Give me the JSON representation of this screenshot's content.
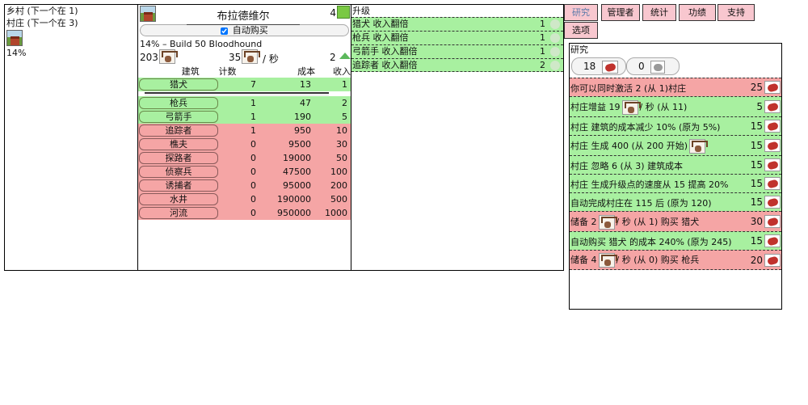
{
  "left": {
    "line1": "乡村 (下一个在 1)",
    "line2": "村庄 (下一个在 3)",
    "percent": "14%"
  },
  "village": {
    "name": "布拉德维尔",
    "count": "4",
    "autobuy_label": "自动购买",
    "autobuy_checked": true,
    "progress_text": "14% – Build 50 Bloodhound",
    "stat_total": "203",
    "stat_rate": "35",
    "stat_rate_unit": "/ 秒",
    "stat_upgrades": "2",
    "headers": {
      "name": "建筑",
      "count": "计数",
      "cost": "成本",
      "income": "收入"
    },
    "buildings": [
      {
        "name": "猎犬",
        "count": "7",
        "cost": "13",
        "income": "1",
        "state": "green"
      },
      {
        "name": "枪兵",
        "count": "1",
        "cost": "47",
        "income": "2",
        "state": "green"
      },
      {
        "name": "弓箭手",
        "count": "1",
        "cost": "190",
        "income": "5",
        "state": "green"
      },
      {
        "name": "追踪者",
        "count": "1",
        "cost": "950",
        "income": "10",
        "state": "red"
      },
      {
        "name": "樵夫",
        "count": "0",
        "cost": "9500",
        "income": "30",
        "state": "red"
      },
      {
        "name": "探路者",
        "count": "0",
        "cost": "19000",
        "income": "50",
        "state": "red"
      },
      {
        "name": "侦察兵",
        "count": "0",
        "cost": "47500",
        "income": "100",
        "state": "red"
      },
      {
        "name": "诱捕者",
        "count": "0",
        "cost": "95000",
        "income": "200",
        "state": "red"
      },
      {
        "name": "水井",
        "count": "0",
        "cost": "190000",
        "income": "500",
        "state": "red"
      },
      {
        "name": "河流",
        "count": "0",
        "cost": "950000",
        "income": "1000",
        "state": "red"
      }
    ]
  },
  "upgrades": {
    "title": "升级",
    "items": [
      {
        "text": "猎犬 收入翻倍",
        "num": "1"
      },
      {
        "text": "枪兵 收入翻倍",
        "num": "1"
      },
      {
        "text": "弓箭手 收入翻倍",
        "num": "1"
      },
      {
        "text": "追踪者 收入翻倍",
        "num": "2"
      }
    ]
  },
  "tabs": [
    {
      "label": "研究",
      "active": true
    },
    {
      "label": "管理者",
      "active": false
    },
    {
      "label": "统计",
      "active": false
    },
    {
      "label": "功绩",
      "active": false
    },
    {
      "label": "支持",
      "active": false
    },
    {
      "label": "选项",
      "active": false
    }
  ],
  "research": {
    "title": "研究",
    "meat_count": "18",
    "stone_count": "0",
    "items": [
      {
        "text": "你可以同时激活 2 (从 1)村庄",
        "num": "25",
        "state": "red"
      },
      {
        "text_a": "村庄增益 19",
        "text_b": "/ 秒 (从 11)",
        "num": "5",
        "state": "green",
        "deer": true
      },
      {
        "text": "村庄 建筑的成本减少 10% (原为 5%)",
        "num": "15",
        "state": "green"
      },
      {
        "text_a": "村庄 生成 400 (从 200 开始)",
        "text_b": "",
        "num": "15",
        "state": "green",
        "deer": true
      },
      {
        "text": "村庄 忽略 6 (从 3) 建筑成本",
        "num": "15",
        "state": "green"
      },
      {
        "text": "村庄 生成升级点的速度从 15 提高 20%",
        "num": "15",
        "state": "green"
      },
      {
        "text": "自动完成村庄在 115 后 (原为 120)",
        "num": "15",
        "state": "green"
      },
      {
        "text_a": "储备 2",
        "text_b": "/ 秒 (从 1) 购买 猎犬",
        "num": "30",
        "state": "red",
        "deer": true
      },
      {
        "text": "自动购买 猎犬 的成本 240% (原为 245)",
        "num": "15",
        "state": "green"
      },
      {
        "text_a": "储备 4",
        "text_b": "/ 秒 (从 0) 购买 枪兵",
        "num": "20",
        "state": "red",
        "deer": true
      }
    ]
  }
}
